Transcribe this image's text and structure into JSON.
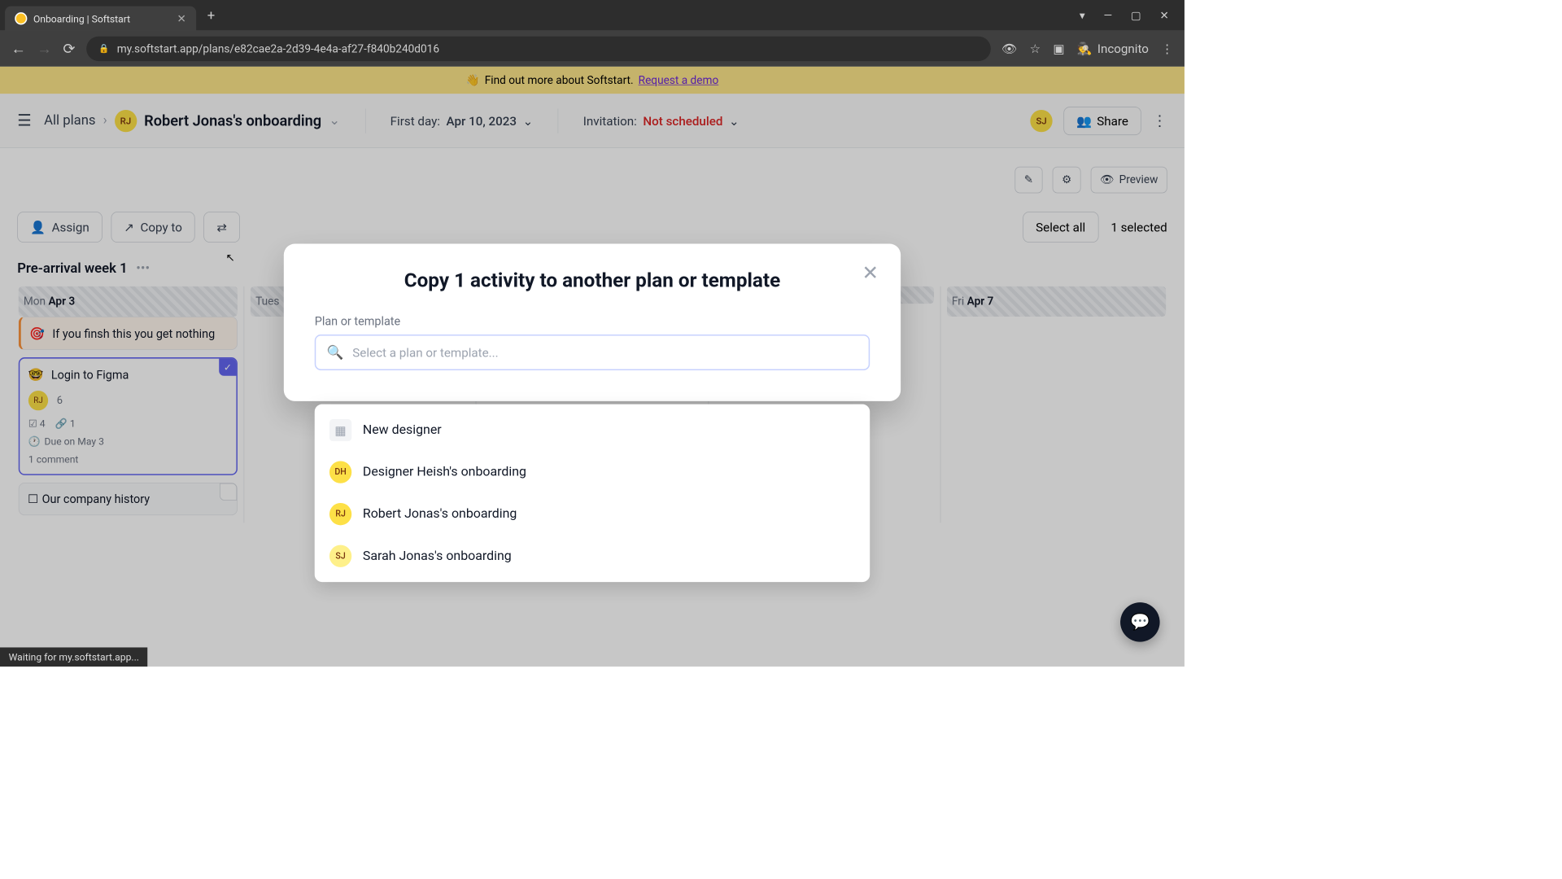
{
  "browser": {
    "tab_title": "Onboarding | Softstart",
    "url": "my.softstart.app/plans/e82cae2a-2d39-4e4a-af27-f840b240d016",
    "incognito_label": "Incognito"
  },
  "banner": {
    "wave": "👋",
    "text": "Find out more about Softstart.",
    "link": "Request a demo"
  },
  "header": {
    "all_plans": "All plans",
    "avatar_initials": "RJ",
    "plan_name": "Robert Jonas's onboarding",
    "first_day_label": "First day:",
    "first_day_value": "Apr 10, 2023",
    "invitation_label": "Invitation:",
    "invitation_value": "Not scheduled",
    "user_initials": "SJ",
    "share_label": "Share"
  },
  "toolbar": {
    "preview_label": "Preview",
    "assign_label": "Assign",
    "copy_to_label": "Copy to",
    "select_all_label": "Select all",
    "selected_count": "1 selected"
  },
  "week": {
    "title": "Pre-arrival week 1",
    "days": [
      {
        "dow": "Mon",
        "date": "Apr 3"
      },
      {
        "dow": "Tues",
        "date": ""
      },
      {
        "dow": "",
        "date": ""
      },
      {
        "dow": "",
        "date": ""
      },
      {
        "dow": "Fri",
        "date": "Apr 7"
      }
    ]
  },
  "cards": {
    "note": {
      "emoji": "🎯",
      "text": "If you finsh this you get nothing"
    },
    "figma": {
      "emoji": "🤓",
      "title": "Login to Figma",
      "assignee": "RJ",
      "count": "6",
      "checklist": "4",
      "links": "1",
      "due": "Due on May 3",
      "comments": "1 comment"
    },
    "history": {
      "title": "Our company history"
    }
  },
  "modal": {
    "title": "Copy 1 activity to another plan or template",
    "label": "Plan or template",
    "placeholder": "Select a plan or template...",
    "options": [
      {
        "icon_type": "template",
        "icon": "▦",
        "label": "New designer"
      },
      {
        "icon_type": "dh",
        "icon": "DH",
        "label": "Designer Heish's onboarding"
      },
      {
        "icon_type": "rj",
        "icon": "RJ",
        "label": "Robert Jonas's onboarding"
      },
      {
        "icon_type": "sj",
        "icon": "SJ",
        "label": "Sarah Jonas's onboarding"
      }
    ]
  },
  "status_bar": "Waiting for my.softstart.app...",
  "colors": {
    "accent_yellow": "#fde047",
    "accent_purple": "#6366f1",
    "danger": "#dc2626"
  }
}
